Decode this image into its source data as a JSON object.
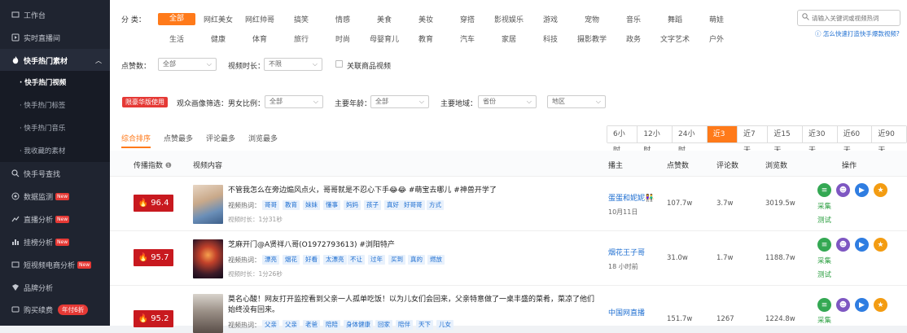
{
  "sidebar": {
    "items": [
      {
        "label": "工作台",
        "icon": "workbench-icon"
      },
      {
        "label": "实时直播间",
        "icon": "live-icon"
      },
      {
        "label": "快手热门素材",
        "icon": "fire-icon"
      },
      {
        "label": "快手号查找",
        "icon": "search-icon"
      },
      {
        "label": "数据监测",
        "icon": "monitor-icon",
        "badge": "New"
      },
      {
        "label": "直播分析",
        "icon": "chart-icon",
        "badge": "New"
      },
      {
        "label": "挂榜分析",
        "icon": "bar-icon",
        "badge": "New"
      },
      {
        "label": "短视频电商分析",
        "icon": "video-icon",
        "badge": "New"
      },
      {
        "label": "品牌分析",
        "icon": "brand-icon"
      },
      {
        "label": "购买续费",
        "icon": "cart-icon",
        "badge": "年付6折"
      }
    ],
    "sub_items": [
      "· 快手热门视频",
      "· 快手热门标签",
      "· 快手热门音乐",
      "· 我收藏的素材"
    ]
  },
  "filters": {
    "category_label": "分  类：",
    "categories_row1": [
      "全部",
      "网红美女",
      "网红帅哥",
      "搞笑",
      "情感",
      "美食",
      "美妆",
      "穿搭",
      "影视娱乐",
      "游戏",
      "宠物",
      "音乐",
      "舞蹈",
      "萌娃"
    ],
    "categories_row2": [
      "生活",
      "健康",
      "体育",
      "旅行",
      "时尚",
      "母婴育儿",
      "教育",
      "汽车",
      "家居",
      "科技",
      "摄影教学",
      "政务",
      "文字艺术",
      "户外"
    ],
    "search_placeholder": "请输入关键词或视频热词",
    "help_link": "怎么快速打造快手爆款视频?",
    "likes_label": "点赞数：",
    "likes_value": "全部",
    "duration_label": "视频时长：",
    "duration_value": "不限",
    "related_products_label": "关联商品视频",
    "luxury_label": "限豪华版使用",
    "audience_label": "观众画像筛选：",
    "gender_label": "男女比例：",
    "gender_value": "全部",
    "age_label": "主要年龄：",
    "age_value": "全部",
    "region_label": "主要地域：",
    "province_value": "省份",
    "area_value": "地区"
  },
  "sort_tabs": [
    "综合排序",
    "点赞最多",
    "评论最多",
    "浏览最多"
  ],
  "time_tabs": [
    "6小时",
    "12小时",
    "24小时",
    "近3天",
    "近7天",
    "近15天",
    "近30天",
    "近60天",
    "近90天"
  ],
  "active_time_tab": 3,
  "table": {
    "headers": [
      "传播指数",
      "视频内容",
      "播主",
      "点赞数",
      "评论数",
      "浏览数",
      "操作"
    ],
    "rows": [
      {
        "score": "96.4",
        "title": "不管我怎么在旁边煽风点火，哥哥就是不忍心下手😂😂 #萌宝去哪儿 #神兽开学了",
        "kw_label": "视频热词：",
        "keywords": [
          "哥哥",
          "教育",
          "妹妹",
          "懂事",
          "妈妈",
          "孩子",
          "真好",
          "好哥哥",
          "方式"
        ],
        "duration": "视频时长：1分31秒",
        "author": "蛋蛋和妮妮👫",
        "date": "10月11日",
        "likes": "107.7w",
        "comments": "3.7w",
        "views": "3019.5w",
        "op_collect": "采集",
        "op_test": "测试"
      },
      {
        "score": "95.7",
        "title": "芝麻开门@A贤祥八哥(O1972793613) #浏阳特产",
        "kw_label": "视频热词：",
        "keywords": [
          "漂亮",
          "烟花",
          "好看",
          "太漂亮",
          "不让",
          "过年",
          "买到",
          "真的",
          "燃放"
        ],
        "duration": "视频时长：1分26秒",
        "author": "烟花王子哥",
        "date": "18 小时前",
        "likes": "31.0w",
        "comments": "1.7w",
        "views": "1188.7w",
        "op_collect": "采集",
        "op_test": "测试"
      },
      {
        "score": "95.2",
        "title": "莫名心酸！网友打开监控看到父亲一人孤单吃饭！以为儿女们会回来，父亲特意做了一桌丰盛的菜肴，菜凉了他们始终没有回来。",
        "kw_label": "视频热词：",
        "keywords": [
          "父亲",
          "父亲",
          "老爸",
          "陪陪",
          "身体健康",
          "回家",
          "陪伴",
          "天下",
          "儿女"
        ],
        "duration": "",
        "author": "中国网直播",
        "date": "",
        "likes": "151.7w",
        "comments": "1267",
        "views": "1224.8w",
        "op_collect": "采集",
        "op_test": ""
      }
    ]
  },
  "colors": {
    "accent": "#ff7a1a",
    "score_bg": "#c8191f",
    "link": "#1f6fd1",
    "sidebar_bg": "#1f2430",
    "op_green": "#34a853",
    "op_purple": "#7e57c2",
    "op_blue": "#2f7de1",
    "op_orange": "#f39c12"
  }
}
